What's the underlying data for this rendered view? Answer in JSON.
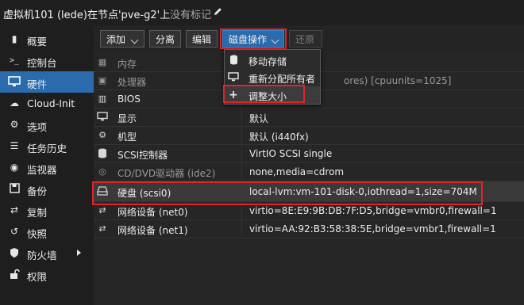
{
  "title": {
    "vm_label": "虚拟机101 (lede)在节点'pve-g2'上",
    "tags_label": "没有标记"
  },
  "sidebar": {
    "items": [
      {
        "label": "概要",
        "icon": "book-icon"
      },
      {
        "label": "控制台",
        "icon": "terminal-icon"
      },
      {
        "label": "硬件",
        "icon": "desktop-icon",
        "active": true
      },
      {
        "label": "Cloud-Init",
        "icon": "cloud-icon"
      },
      {
        "label": "选项",
        "icon": "gear-icon"
      },
      {
        "label": "任务历史",
        "icon": "list-icon"
      },
      {
        "label": "监视器",
        "icon": "eye-icon"
      },
      {
        "label": "备份",
        "icon": "floppy-icon"
      },
      {
        "label": "复制",
        "icon": "retweet-icon"
      },
      {
        "label": "快照",
        "icon": "history-icon"
      },
      {
        "label": "防火墙",
        "icon": "shield-icon"
      },
      {
        "label": "权限",
        "icon": "unlock-icon"
      }
    ]
  },
  "toolbar": {
    "add_label": "添加",
    "detach_label": "分离",
    "edit_label": "编辑",
    "disk_action_label": "磁盘操作",
    "revert_label": "还原"
  },
  "disk_menu": {
    "items": [
      {
        "label": "移动存储",
        "icon": "database-icon"
      },
      {
        "label": "重新分配所有者",
        "icon": "desktop-icon"
      },
      {
        "label": "调整大小",
        "icon": "plus-icon"
      }
    ]
  },
  "hardware": {
    "rows": [
      {
        "name": "内存",
        "value": "",
        "icon": "memory-icon"
      },
      {
        "name": "处理器",
        "value": "ores) [cpuunits=1025]",
        "icon": "cpu-icon"
      },
      {
        "name": "BIOS",
        "value": "",
        "icon": "microchip-icon"
      },
      {
        "name": "显示",
        "value": "默认",
        "icon": "desktop-icon"
      },
      {
        "name": "机型",
        "value": "默认 (i440fx)",
        "icon": "cogs-icon"
      },
      {
        "name": "SCSI控制器",
        "value": "VirtIO SCSI single",
        "icon": "database-icon"
      },
      {
        "name": "CD/DVD驱动器 (ide2)",
        "value": "none,media=cdrom",
        "icon": "cdrom-icon"
      },
      {
        "name": "硬盘 (scsi0)",
        "value": "local-lvm:vm-101-disk-0,iothread=1,size=704M",
        "icon": "hdd-icon"
      },
      {
        "name": "网络设备 (net0)",
        "value": "virtio=8E:E9:9B:DB:7F:D5,bridge=vmbr0,firewall=1",
        "icon": "exchange-icon"
      },
      {
        "name": "网络设备 (net1)",
        "value": "virtio=AA:92:B3:58:38:5E,bridge=vmbr1,firewall=1",
        "icon": "exchange-icon"
      }
    ]
  },
  "colors": {
    "accent": "#2a6bad",
    "highlight_box": "#e0242a"
  }
}
